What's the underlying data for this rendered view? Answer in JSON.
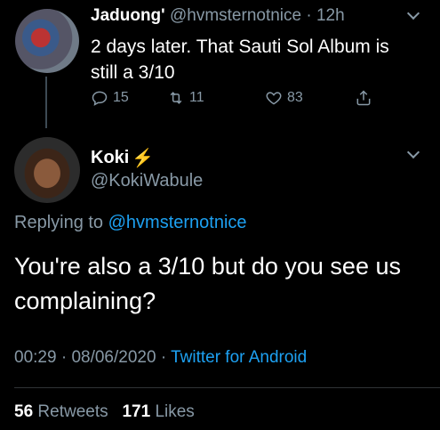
{
  "tweet1": {
    "name": "Jaduong'",
    "handle": "@hvmsternotnice",
    "separator": "·",
    "time": "12h",
    "text": "2 days later. That Sauti Sol Album is still a 3/10",
    "reply_count": "15",
    "retweet_count": "11",
    "like_count": "83"
  },
  "tweet2": {
    "name": "Koki",
    "handle": "@KokiWabule",
    "replying_prefix": "Replying to",
    "replying_to": "@hvmsternotnice",
    "text": "You're also a 3/10 but do you see us complaining?",
    "time": "00:29",
    "date": "08/06/2020",
    "separator": "·",
    "source": "Twitter for Android",
    "retweets": "56",
    "retweets_label": "Retweets",
    "likes": "171",
    "likes_label": "Likes"
  },
  "icons": {
    "reply": "reply-icon",
    "retweet": "retweet-icon",
    "like": "heart-icon",
    "share": "share-icon",
    "more": "chevron-down-icon",
    "emoji": "lightning-icon"
  },
  "colors": {
    "background": "#000000",
    "secondary_text": "#8899a6",
    "link": "#1da1f2",
    "bolt": "#f5b31a"
  }
}
